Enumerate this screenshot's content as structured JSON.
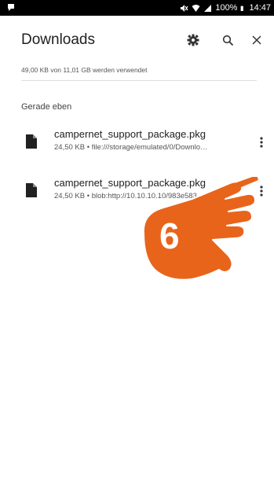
{
  "status_bar": {
    "battery": "100%",
    "time": "14:47"
  },
  "app_bar": {
    "title": "Downloads",
    "settings_icon": "gear-icon",
    "search_icon": "search-icon",
    "close_icon": "close-icon"
  },
  "storage_usage": "49,00 KB von 11,01 GB werden verwendet",
  "section_header": "Gerade eben",
  "downloads": [
    {
      "name": "campernet_support_package.pkg",
      "meta": "24,50 KB • file:///storage/emulated/0/Downlo…"
    },
    {
      "name": "campernet_support_package.pkg",
      "meta": "24,50 KB • blob:http://10.10.10.10/983e583"
    }
  ],
  "overlay": {
    "step_number": "6",
    "color": "#e8641b"
  }
}
